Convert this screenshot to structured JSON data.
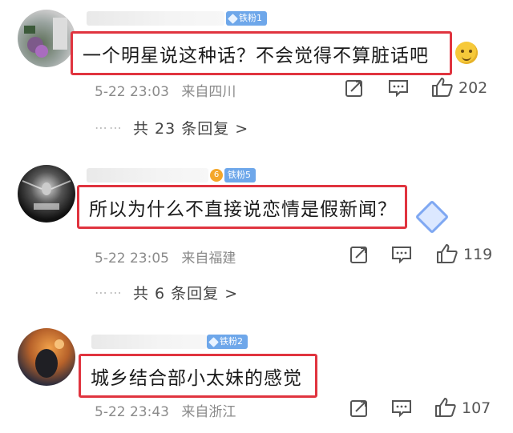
{
  "comments": [
    {
      "badge": "铁粉1",
      "text": "一个明星说这种话？不会觉得不算脏话吧",
      "date": "5-22 23:03",
      "location": "来自四川",
      "likes": "202",
      "replies": "共 23 条回复 >",
      "trailing_icon": "smirk-emoji-icon"
    },
    {
      "badge": "铁粉5",
      "rank": "6",
      "text": "所以为什么不直接说恋情是假新闻？",
      "date": "5-22 23:05",
      "location": "来自福建",
      "likes": "119",
      "replies": "共 6 条回复 >",
      "trailing_icon": "diamond-sparkle-icon"
    },
    {
      "badge": "铁粉2",
      "text": "城乡结合部小太妹的感觉",
      "date": "5-22 23:43",
      "location": "来自浙江",
      "likes": "107"
    }
  ],
  "colors": {
    "highlight_border": "#e0343f",
    "badge": "#6ea7ea",
    "meta_text": "#8a8a8a"
  }
}
